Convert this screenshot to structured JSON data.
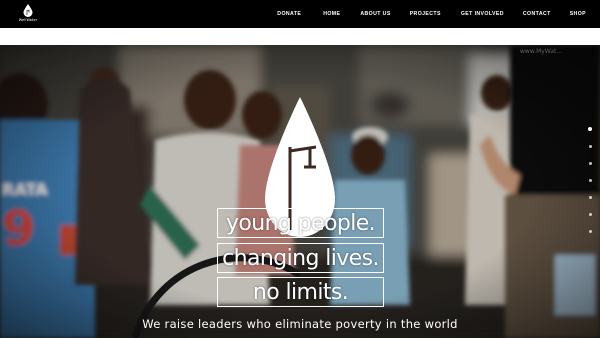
{
  "header": {
    "logo_text": "WellWater",
    "nav": [
      {
        "label": "DONATE"
      },
      {
        "label": "HOME"
      },
      {
        "label": "ABOUT US"
      },
      {
        "label": "PROJECTS"
      },
      {
        "label": "GET INVOLVED"
      },
      {
        "label": "CONTACT"
      },
      {
        "label": "SHOP"
      }
    ]
  },
  "hero": {
    "slogan": [
      "young people.",
      "changing lives.",
      "no limits."
    ],
    "mission": "We raise leaders who eliminate poverty in the world",
    "slides": {
      "count": 7,
      "active": 0
    }
  },
  "colors": {
    "nav_bg": "#000000",
    "text": "#ffffff"
  }
}
